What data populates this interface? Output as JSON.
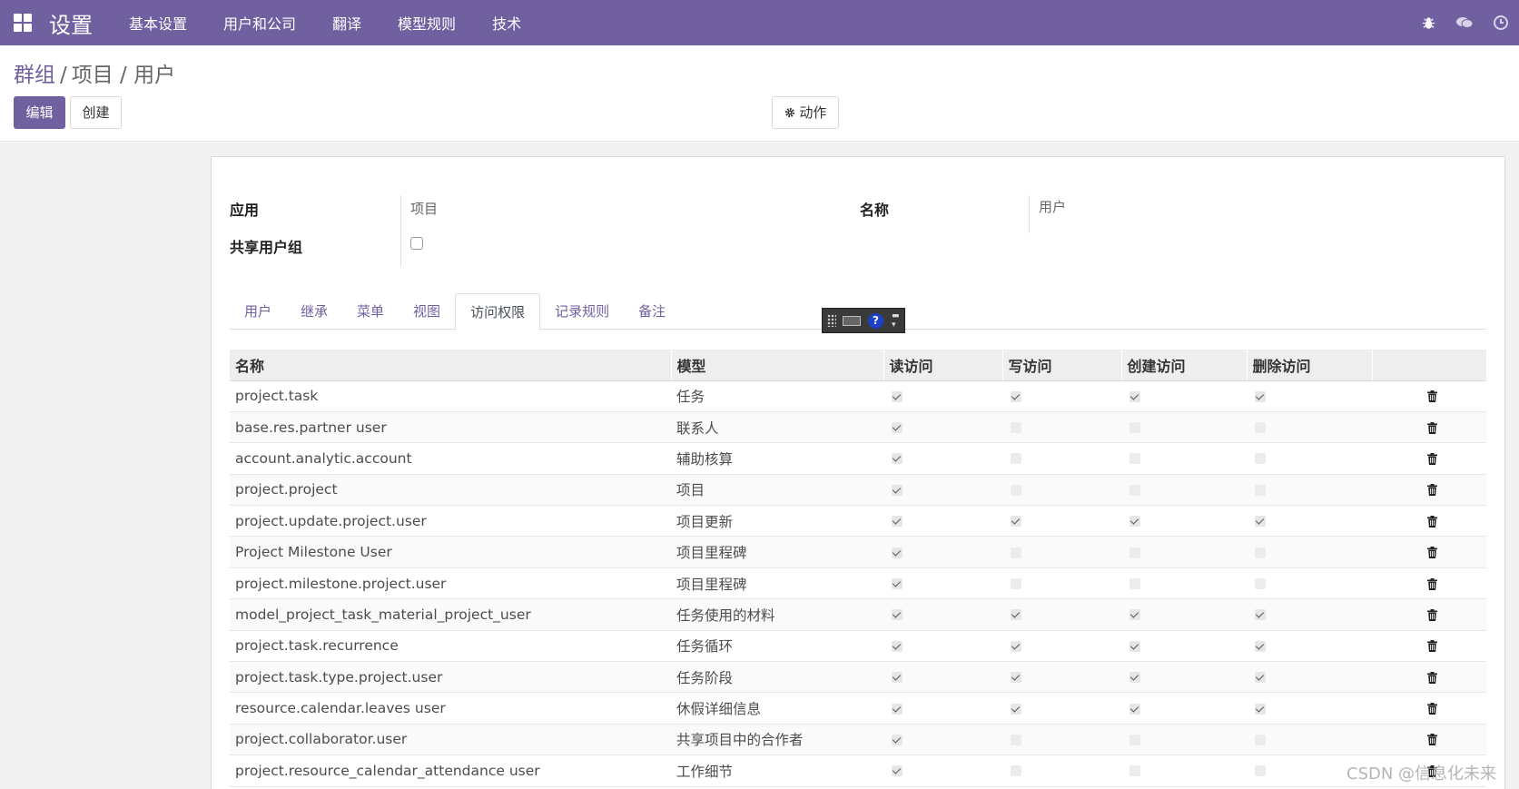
{
  "navbar": {
    "app_title": "设置",
    "menu": [
      "基本设置",
      "用户和公司",
      "翻译",
      "模型规则",
      "技术"
    ]
  },
  "breadcrumb": {
    "group": "群组",
    "sep": "/",
    "record": "项目 / 用户"
  },
  "buttons": {
    "edit": "编辑",
    "create": "创建",
    "action": "动作"
  },
  "form": {
    "app_label": "应用",
    "app_value": "项目",
    "name_label": "名称",
    "name_value": "用户",
    "share_label": "共享用户组"
  },
  "tabs": [
    "用户",
    "继承",
    "菜单",
    "视图",
    "访问权限",
    "记录规则",
    "备注"
  ],
  "active_tab": "访问权限",
  "table": {
    "headers": [
      "名称",
      "模型",
      "读访问",
      "写访问",
      "创建访问",
      "删除访问"
    ],
    "rows": [
      {
        "name": "project.task",
        "model": "任务",
        "read": true,
        "write": true,
        "create": true,
        "unlink": true
      },
      {
        "name": "base.res.partner user",
        "model": "联系人",
        "read": true,
        "write": false,
        "create": false,
        "unlink": false
      },
      {
        "name": "account.analytic.account",
        "model": "辅助核算",
        "read": true,
        "write": false,
        "create": false,
        "unlink": false
      },
      {
        "name": "project.project",
        "model": "项目",
        "read": true,
        "write": false,
        "create": false,
        "unlink": false
      },
      {
        "name": "project.update.project.user",
        "model": "项目更新",
        "read": true,
        "write": true,
        "create": true,
        "unlink": true
      },
      {
        "name": "Project Milestone User",
        "model": "项目里程碑",
        "read": true,
        "write": false,
        "create": false,
        "unlink": false
      },
      {
        "name": "project.milestone.project.user",
        "model": "项目里程碑",
        "read": true,
        "write": false,
        "create": false,
        "unlink": false
      },
      {
        "name": "model_project_task_material_project_user",
        "model": "任务使用的材料",
        "read": true,
        "write": true,
        "create": true,
        "unlink": true
      },
      {
        "name": "project.task.recurrence",
        "model": "任务循环",
        "read": true,
        "write": true,
        "create": true,
        "unlink": true
      },
      {
        "name": "project.task.type.project.user",
        "model": "任务阶段",
        "read": true,
        "write": true,
        "create": true,
        "unlink": true
      },
      {
        "name": "resource.calendar.leaves user",
        "model": "休假详细信息",
        "read": true,
        "write": true,
        "create": true,
        "unlink": true
      },
      {
        "name": "project.collaborator.user",
        "model": "共享项目中的合作者",
        "read": true,
        "write": false,
        "create": false,
        "unlink": false
      },
      {
        "name": "project.resource_calendar_attendance user",
        "model": "工作细节",
        "read": true,
        "write": false,
        "create": false,
        "unlink": false
      }
    ]
  },
  "ime": {
    "help": "?"
  },
  "watermark": "CSDN @信息化未来",
  "colors": {
    "brand": "#7160a0"
  },
  "icons": [
    "apps-icon",
    "bug-icon",
    "chat-icon",
    "clock-icon",
    "gear-icon",
    "trash-icon",
    "keyboard-icon",
    "help-icon"
  ]
}
